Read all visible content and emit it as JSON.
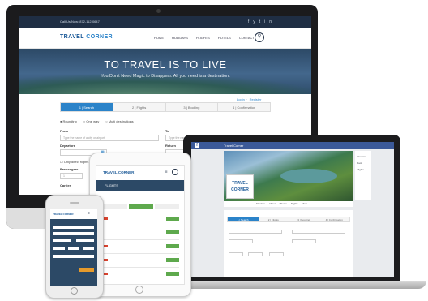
{
  "desktop": {
    "topbar_text": "Call Us Now: 872-112-0647",
    "social_icons": [
      "f",
      "y",
      "t",
      "in"
    ],
    "logo_part1": "TRAVEL",
    "logo_part2": " CORNER",
    "menu": [
      "HOME",
      "HOLIDAYS",
      "FLIGHTS",
      "HOTELS",
      "CONTACT"
    ],
    "search_icon": "search-icon",
    "hero_title": "TO TRAVEL IS TO LIVE",
    "hero_subtitle": "You Don't Need Magic to Disappear. All you need is a destination.",
    "login": "Login",
    "register": "Register",
    "steps": [
      "1 | Search",
      "2 | Flights",
      "3 | Booking",
      "4 | Confirmation"
    ],
    "trip_options": [
      "Roundtrip",
      "One way",
      "Multi destinations"
    ],
    "from_label": "From",
    "to_label": "To",
    "from_placeholder": "Type the name of a city or airport",
    "to_placeholder": "Type the name of a city or airport",
    "departure_label": "Departure",
    "return_label": "Return",
    "direct_flights": "Only direct flights",
    "passengers_label": "Passengers",
    "passengers_value": "1",
    "carrier_label": "Carrier"
  },
  "laptop": {
    "page_name": "Travel Corner",
    "logo_part1": "TRAVEL",
    "logo_part2": "CORNER",
    "tabs": "Timeline About Photos Flights More",
    "sidebar": [
      "Timeline",
      "Book",
      "Flights"
    ],
    "steps": [
      "1 | Search",
      "2 | Flights",
      "3 | Booking",
      "4 | Confirmation"
    ]
  },
  "tablet": {
    "logo": "TRAVEL CORNER",
    "section": "FLIGHTS",
    "select_label": "Select"
  },
  "phone": {
    "logo": "TRAVEL CORNER"
  },
  "colors": {
    "accent": "#2b83c9",
    "navy": "#1f2e44",
    "facebook": "#3b5998",
    "green": "#5ea94d",
    "orange": "#e69a2b"
  }
}
